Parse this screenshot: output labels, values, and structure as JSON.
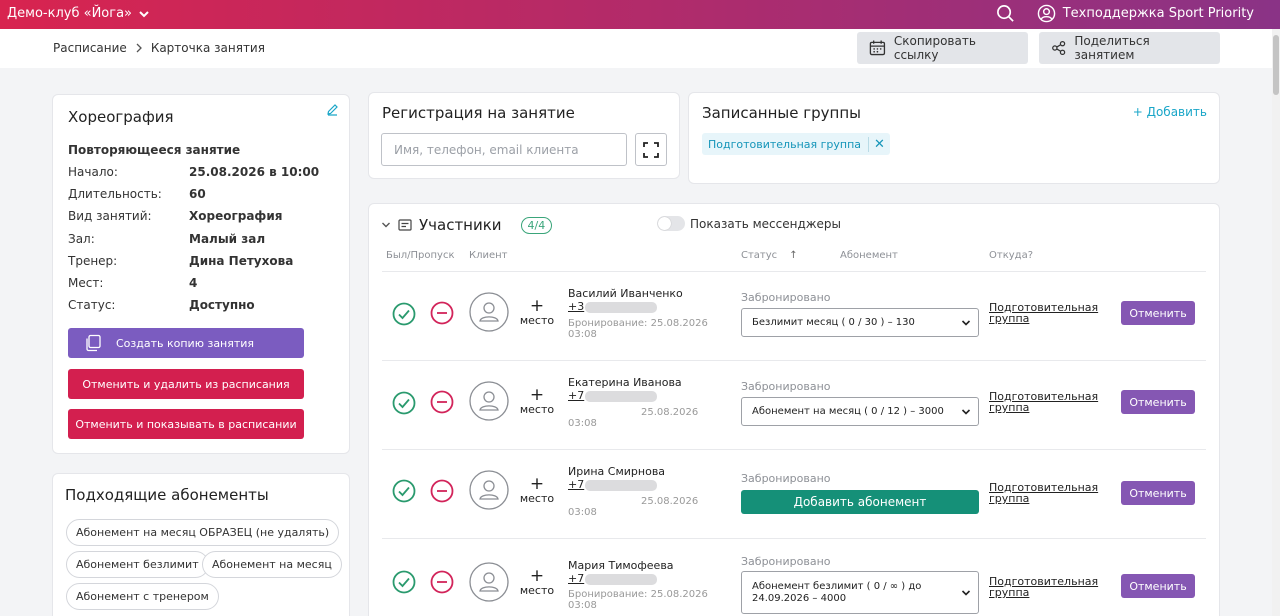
{
  "topbar": {
    "club": "Демо-клуб «Йога»",
    "support": "Техподдержка Sport Priority"
  },
  "breadcrumbs": [
    "Расписание",
    "Карточка занятия"
  ],
  "header_buttons": {
    "copy_link": "Скопировать ссылку",
    "share": "Поделиться занятием"
  },
  "class_card": {
    "title": "Хореография",
    "type": "Повторяющееся занятие",
    "fields": [
      {
        "label": "Начало:",
        "value": "25.08.2026 в 10:00"
      },
      {
        "label": "Длительность:",
        "value": "60"
      },
      {
        "label": "Вид занятий:",
        "value": "Хореография"
      },
      {
        "label": "Зал:",
        "value": "Малый зал"
      },
      {
        "label": "Тренер:",
        "value": "Дина Петухова"
      },
      {
        "label": "Мест:",
        "value": "4"
      },
      {
        "label": "Статус:",
        "value": "Доступно"
      }
    ],
    "buttons": {
      "copy": "Создать копию занятия",
      "cancel_delete": "Отменить и удалить из расписания",
      "cancel_show": "Отменить и показывать в расписании"
    },
    "colors": {
      "copy": "#7b5cc0",
      "danger": "#d31f4f"
    }
  },
  "subscriptions": {
    "title": "Подходящие абонементы",
    "items": [
      "Абонемент на месяц ОБРАЗЕЦ (не удалять)",
      "Абонемент безлимит",
      "Абонемент на месяц",
      "Абонемент с тренером"
    ]
  },
  "registration": {
    "title": "Регистрация на занятие",
    "placeholder": "Имя, телефон, email клиента"
  },
  "groups": {
    "title": "Записанные группы",
    "add": "+ Добавить",
    "chip": "Подготовительная группа"
  },
  "participants": {
    "title": "Участники",
    "count": "4/4",
    "toggle_label": "Показать мессенджеры",
    "columns": {
      "attendance": "Был/Пропуск",
      "client": "Клиент",
      "status": "Статус",
      "status_sort": "↑",
      "subscription": "Абонемент",
      "source": "Откуда?"
    },
    "place_label": "место",
    "cancel_label": "Отменить",
    "rows": [
      {
        "name": "Василий Иванченко",
        "phone_prefix": "+3",
        "booking_line1": "Бронирование: 25.08.2026",
        "booking_line2": "03:08",
        "status": "Забронировано",
        "subscription": "Безлимит месяц ( 0 / 30 ) – 130",
        "source_line1": "Подготовительная",
        "source_line2": "группа"
      },
      {
        "name": "Екатерина Иванова",
        "phone_prefix": "+7",
        "booking_line1": "25.08.2026",
        "booking_line2": "03:08",
        "status": "Забронировано",
        "subscription": "Абонемент на месяц ( 0 / 12 ) – 3000",
        "source_line1": "Подготовительная",
        "source_line2": "группа"
      },
      {
        "name": "Ирина Смирнова",
        "phone_prefix": "+7",
        "booking_line1": "25.08.2026",
        "booking_line2": "03:08",
        "status": "Забронировано",
        "add_subscription": "Добавить абонемент",
        "source_line1": "Подготовительная",
        "source_line2": "группа"
      },
      {
        "name": "Мария Тимофеева",
        "phone_prefix": "+7",
        "booking_line1": "Бронирование: 25.08.2026",
        "booking_line2": "03:08",
        "status": "Забронировано",
        "subscription_line1": "Абонемент безлимит ( 0 / ∞ ) до",
        "subscription_line2": "24.09.2026 – 4000",
        "source_line1": "Подготовительная",
        "source_line2": "группа"
      }
    ]
  },
  "colors": {
    "topbar_start": "#d8244f",
    "topbar_end": "#8a3386",
    "present": "#2a9a6e",
    "absent": "#d2245a",
    "cancel": "#8557b3",
    "add_subscription": "#159078",
    "link": "#1aa6c8"
  }
}
